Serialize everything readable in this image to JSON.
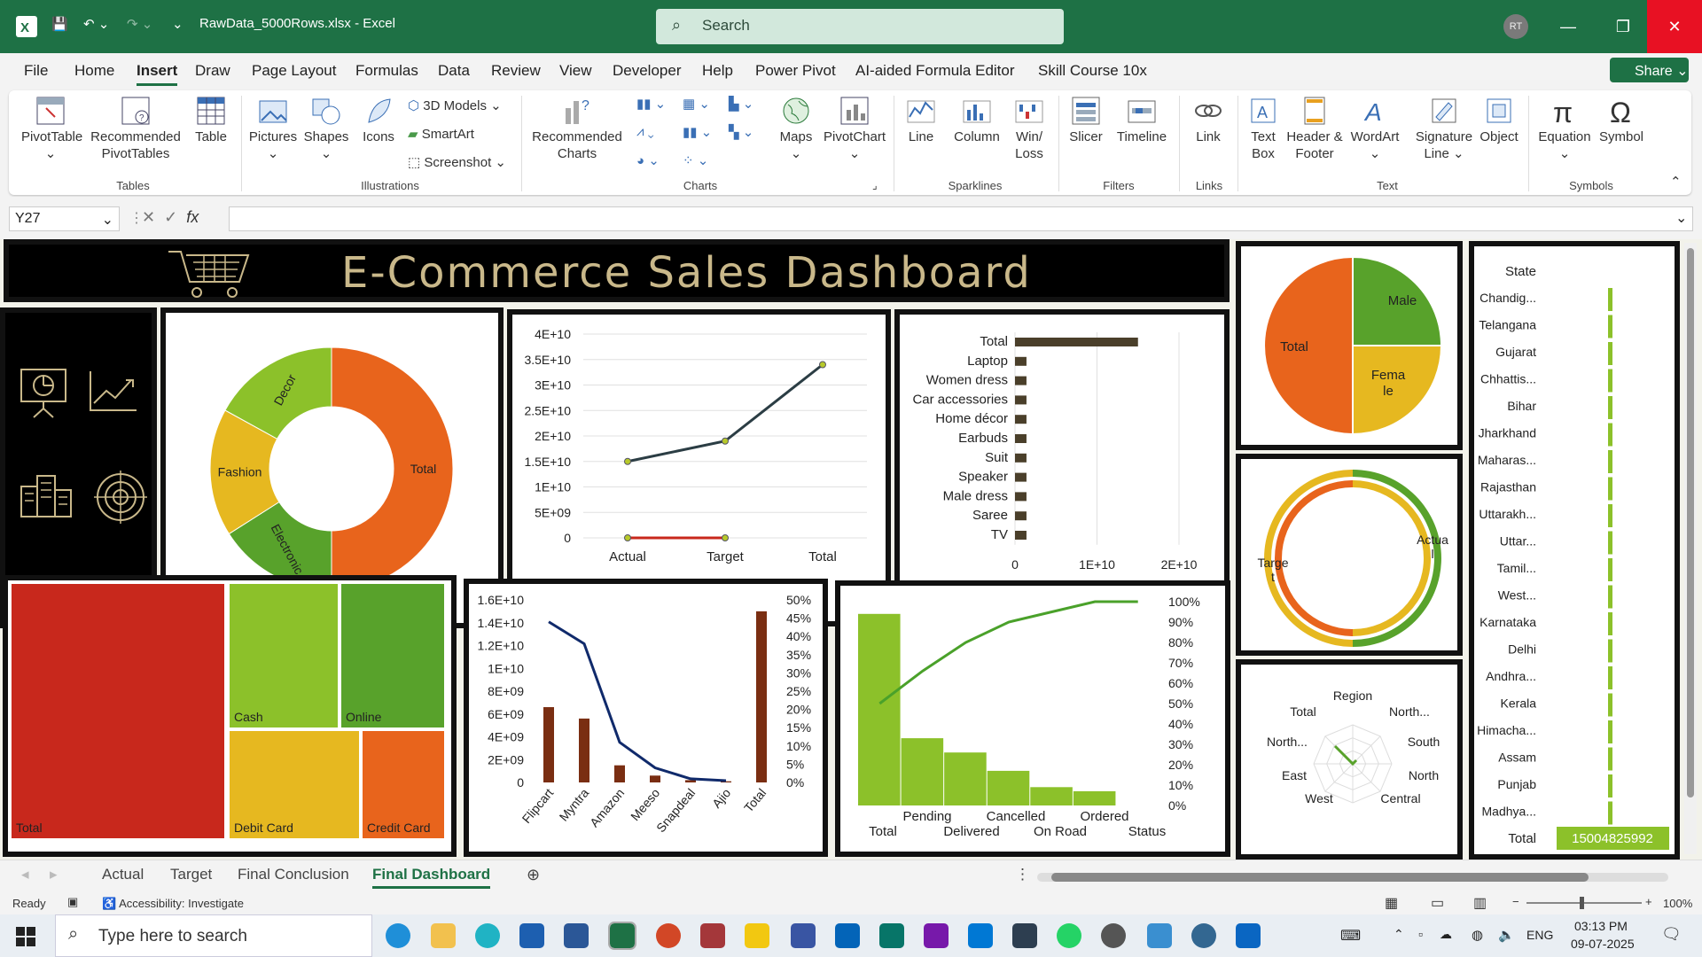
{
  "titlebar": {
    "filename": "RawData_5000Rows.xlsx",
    "app": "Excel",
    "search_placeholder": "Search",
    "avatar": "RT"
  },
  "menu": {
    "items": [
      "File",
      "Home",
      "Insert",
      "Draw",
      "Page Layout",
      "Formulas",
      "Data",
      "Review",
      "View",
      "Developer",
      "Help",
      "Power Pivot",
      "AI-aided Formula Editor",
      "Skill Course 10x"
    ],
    "active": "Insert",
    "share_label": "Share"
  },
  "ribbon": {
    "pivottable": "PivotTable",
    "recommended_pivottables": "Recommended PivotTables",
    "table": "Table",
    "pictures": "Pictures",
    "shapes": "Shapes",
    "icons": "Icons",
    "models3d": "3D Models",
    "smartart": "SmartArt",
    "screenshot": "Screenshot",
    "recommended_charts": "Recommended Charts",
    "maps": "Maps",
    "pivotchart": "PivotChart",
    "line": "Line",
    "column": "Column",
    "winloss": "Win/ Loss",
    "slicer": "Slicer",
    "timeline": "Timeline",
    "link": "Link",
    "textbox": "Text Box",
    "header_footer": "Header & Footer",
    "wordart": "WordArt",
    "signature": "Signature Line",
    "object": "Object",
    "equation": "Equation",
    "symbol": "Symbol",
    "groups": {
      "tables": "Tables",
      "illustrations": "Illustrations",
      "charts": "Charts",
      "sparklines": "Sparklines",
      "filters": "Filters",
      "links": "Links",
      "text": "Text",
      "symbols": "Symbols"
    }
  },
  "formula_bar": {
    "name_box": "Y27",
    "fx": "fx",
    "content": ""
  },
  "dashboard": {
    "title": "E-Commerce Sales Dashboard"
  },
  "colors": {
    "orange": "#e8641c",
    "green": "#58a22b",
    "yellow": "#e6b820",
    "lime": "#8cc12a",
    "red": "#c8281c",
    "brown": "#7a2e12",
    "navy": "#102a6b"
  },
  "chart_data": [
    {
      "type": "pie",
      "name": "category-donut",
      "labels": [
        "Total",
        "Electronic",
        "Fashion",
        "Decor"
      ],
      "values": [
        50,
        16,
        17,
        17
      ],
      "colors": [
        "#e8641c",
        "#58a22b",
        "#e6b820",
        "#8cc12a"
      ]
    },
    {
      "type": "line",
      "name": "actual-target-line",
      "categories": [
        "Actual",
        "Target",
        "Total"
      ],
      "series": [
        {
          "values": [
            15000000000,
            19000000000,
            34000000000
          ],
          "color": "#2b3d44"
        },
        {
          "values": [
            0,
            0
          ],
          "color": "#c8281c"
        }
      ],
      "yticks": [
        "0",
        "5E+09",
        "1E+10",
        "1.5E+10",
        "2E+10",
        "2.5E+10",
        "3E+10",
        "3.5E+10",
        "4E+10"
      ],
      "ylim": [
        0,
        40000000000
      ]
    },
    {
      "type": "bar",
      "name": "product-bars",
      "categories": [
        "Total",
        "Laptop",
        "Women dress",
        "Car accessories",
        "Home décor",
        "Earbuds",
        "Suit",
        "Speaker",
        "Male dress",
        "Saree",
        "TV"
      ],
      "values": [
        15000000000,
        1400000000,
        1400000000,
        1400000000,
        1400000000,
        1400000000,
        1400000000,
        1400000000,
        1400000000,
        1400000000,
        1400000000
      ],
      "xticks": [
        "0",
        "1E+10",
        "2E+10"
      ],
      "xlim": [
        0,
        20000000000
      ]
    },
    {
      "type": "pie",
      "name": "gender-pie",
      "labels": [
        "Total",
        "Male",
        "Female"
      ],
      "display_labels": [
        "Total",
        "Male",
        "Fema le"
      ],
      "values": [
        50,
        25,
        25
      ],
      "colors": [
        "#e8641c",
        "#58a22b",
        "#e6b820"
      ]
    },
    {
      "type": "pie",
      "name": "actual-target-rings",
      "labels": [
        "Target",
        "Actual"
      ],
      "display_labels": [
        "Targe t",
        "Actua l"
      ]
    },
    {
      "type": "heatmap",
      "name": "payment-treemap",
      "labels": [
        "Total",
        "Cash",
        "Online",
        "Debit Card",
        "Credit Card"
      ],
      "colors": [
        "#c8281c",
        "#8cc12a",
        "#58a22b",
        "#e6b820",
        "#e8641c"
      ]
    },
    {
      "type": "bar",
      "name": "platform-pareto",
      "categories": [
        "Flipcart",
        "Myntra",
        "Amazon",
        "Meeso",
        "Snapdeal",
        "Ajio",
        "Total"
      ],
      "bars": [
        6600000000,
        5600000000,
        1500000000,
        600000000,
        200000000,
        100000000,
        15000000000
      ],
      "line_pct": [
        44,
        38,
        11,
        4,
        1,
        0.5,
        0
      ],
      "yticks": [
        "0",
        "2E+09",
        "4E+09",
        "6E+09",
        "8E+09",
        "1E+10",
        "1.2E+10",
        "1.4E+10",
        "1.6E+10"
      ],
      "ylim": [
        0,
        16000000000
      ],
      "y2ticks": [
        "0%",
        "5%",
        "10%",
        "15%",
        "20%",
        "25%",
        "30%",
        "35%",
        "40%",
        "45%",
        "50%"
      ],
      "y2lim": [
        0,
        50
      ]
    },
    {
      "type": "bar",
      "name": "status-pareto",
      "categories": [
        "Total",
        "Pending",
        "Delivered",
        "Cancelled",
        "On Road",
        "Ordered",
        "Status"
      ],
      "bars": [
        94,
        33,
        26,
        17,
        9,
        7
      ],
      "bar_max": 100,
      "line_pct": [
        50,
        66,
        80,
        90,
        95,
        100,
        100
      ],
      "y2ticks": [
        "0%",
        "10%",
        "20%",
        "30%",
        "40%",
        "50%",
        "60%",
        "70%",
        "80%",
        "90%",
        "100%"
      ],
      "y2lim": [
        0,
        100
      ]
    },
    {
      "type": "radar",
      "name": "region-radar",
      "labels": [
        "Region",
        "North...",
        "South",
        "North",
        "Central",
        "West",
        "East",
        "North...",
        "Total"
      ]
    },
    {
      "type": "bar",
      "name": "state-table",
      "header": "State",
      "states": [
        "Chandig...",
        "Telangana",
        "Gujarat",
        "Chhattis...",
        "Bihar",
        "Jharkhand",
        "Maharas...",
        "Rajasthan",
        "Uttarakh...",
        "Uttar...",
        "Tamil...",
        "West...",
        "Karnataka",
        "Delhi",
        "Andhra...",
        "Kerala",
        "Himacha...",
        "Assam",
        "Punjab",
        "Madhya..."
      ],
      "total_label": "Total",
      "total_value": "15004825992"
    }
  ],
  "sheet_tabs": {
    "items": [
      "Actual",
      "Target",
      "Final Conclusion",
      "Final Dashboard"
    ],
    "active": "Final Dashboard"
  },
  "statusbar": {
    "ready": "Ready",
    "accessibility": "Accessibility: Investigate",
    "zoom": "100%"
  },
  "taskbar": {
    "search_placeholder": "Type here to search",
    "lang": "ENG",
    "time": "03:13 PM",
    "date": "09-07-2025"
  }
}
